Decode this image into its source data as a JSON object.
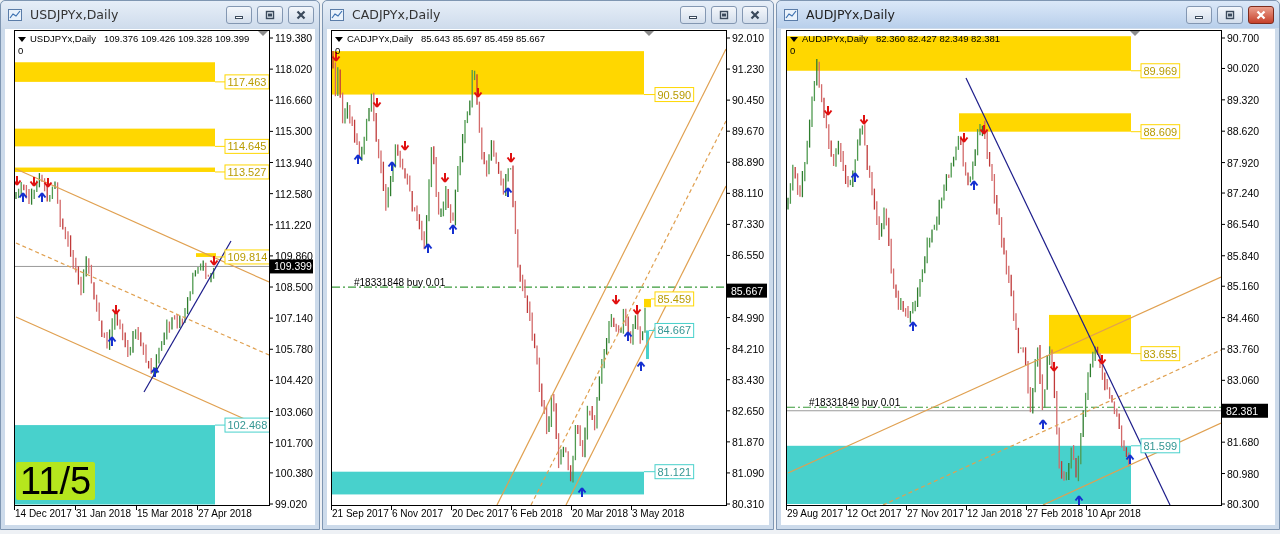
{
  "windows": [
    {
      "title": "USDJPYx,Daily",
      "active": false,
      "symbol": "USDJPYx,Daily",
      "ohlc": "109.376 109.426 109.328 109.399",
      "indicator_value": "0",
      "price_ticks": [
        "119.380",
        "118.020",
        "116.660",
        "115.300",
        "113.940",
        "112.580",
        "111.220",
        "109.860",
        "108.500",
        "107.140",
        "105.780",
        "104.420",
        "103.060",
        "101.700",
        "100.380",
        "99.020"
      ],
      "date_ticks": [
        "14 Dec 2017",
        "31 Jan 2018",
        "15 Mar 2018",
        "27 Apr 2018"
      ],
      "current_price": "109.399",
      "zones": [
        {
          "label": "117.463",
          "color": "#ffd700"
        },
        {
          "label": "114.645",
          "color": "#ffd700"
        },
        {
          "label": "113.527",
          "color": "#ffd700"
        },
        {
          "label": "109.814",
          "color": "#ffd700"
        },
        {
          "label": "102.468",
          "color": "#48d1cc"
        }
      ],
      "badge": "11/5"
    },
    {
      "title": "CADJPYx,Daily",
      "active": false,
      "symbol": "CADJPYx,Daily",
      "ohlc": "85.643 85.697 85.459 85.667",
      "indicator_value": "0",
      "price_ticks": [
        "92.010",
        "91.230",
        "90.450",
        "89.670",
        "88.890",
        "88.110",
        "87.330",
        "86.550",
        "84.990",
        "84.210",
        "83.430",
        "82.650",
        "81.870",
        "81.090",
        "80.310"
      ],
      "date_ticks": [
        "21 Sep 2017",
        "6 Nov 2017",
        "20 Dec 2017",
        "6 Feb 2018",
        "20 Mar 2018",
        "3 May 2018"
      ],
      "current_price": "85.667",
      "order": "#18331848 buy 0.01",
      "zones": [
        {
          "label": "90.590",
          "color": "#ffd700"
        },
        {
          "label": "85.459",
          "color": "#ffd700"
        },
        {
          "label": "84.667",
          "color": "#48d1cc"
        },
        {
          "label": "81.121",
          "color": "#48d1cc"
        }
      ]
    },
    {
      "title": "AUDJPYx,Daily",
      "active": true,
      "symbol": "AUDJPYx,Daily",
      "ohlc": "82.360 82.427 82.349 82.381",
      "indicator_value": "0",
      "price_ticks": [
        "90.700",
        "90.020",
        "89.320",
        "88.620",
        "87.920",
        "87.240",
        "86.540",
        "85.840",
        "85.160",
        "84.460",
        "83.760",
        "83.060",
        "81.680",
        "80.980",
        "80.300"
      ],
      "date_ticks": [
        "29 Aug 2017",
        "12 Oct 2017",
        "27 Nov 2017",
        "12 Jan 2018",
        "27 Feb 2018",
        "10 Apr 2018"
      ],
      "current_price": "82.381",
      "order": "#18331849 buy 0.01",
      "zones": [
        {
          "label": "89.969",
          "color": "#ffd700"
        },
        {
          "label": "88.609",
          "color": "#ffd700"
        },
        {
          "label": "83.655",
          "color": "#ffd700"
        },
        {
          "label": "81.599",
          "color": "#48d1cc"
        }
      ]
    }
  ]
}
